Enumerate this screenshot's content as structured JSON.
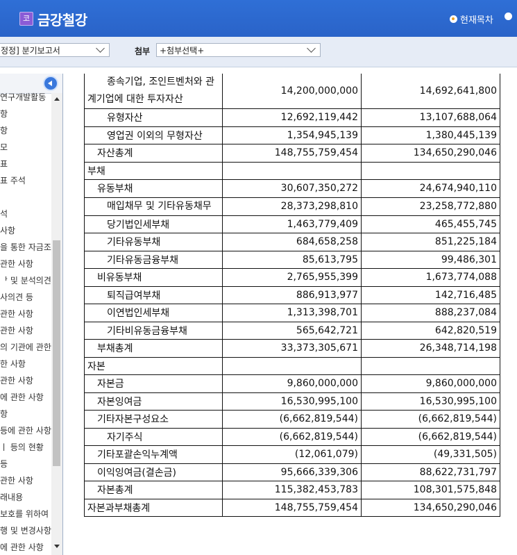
{
  "header": {
    "logo_text": "코",
    "title": "금강철강",
    "radio_current": "현재목차",
    "accent": "#2f6fd6"
  },
  "toolbar": {
    "report_select": "정정] 분기보고서",
    "attach_label": "첨부",
    "attach_select": "+첨부선택+"
  },
  "sidebar": {
    "items": [
      "연구개발활동",
      "항",
      "항",
      "모",
      "표",
      "표 주석",
      "",
      "석",
      " 사항",
      "을 통한 자금조",
      " 관한 사항",
      "ᅡ 및 분석의견",
      "사의견 등",
      "관한 사항",
      "관한 사항",
      "의 기관에 관한",
      "한 사항",
      "관한 사항",
      "에 관한 사항",
      "항",
      "등에 관한 사항",
      "ㅣ 등의 현황",
      " 등",
      "관한 사항",
      "래내용",
      " 보호를 위하여",
      "행 및 변경사항",
      "에 관한 사항"
    ]
  },
  "table": {
    "rows": [
      {
        "label": "종속기업, 조인트벤처와 관계기업에 대한 투자자산",
        "indent": 2,
        "tall": true,
        "current": "14,200,000,000",
        "prior": "14,692,641,800"
      },
      {
        "label": "유형자산",
        "indent": 2,
        "current": "12,692,119,442",
        "prior": "13,107,688,064"
      },
      {
        "label": "영업권 이외의 무형자산",
        "indent": 2,
        "current": "1,354,945,139",
        "prior": "1,380,445,139"
      },
      {
        "label": "자산총계",
        "indent": 1,
        "current": "148,755,759,454",
        "prior": "134,650,290,046"
      },
      {
        "label": "부채",
        "indent": 0,
        "current": "",
        "prior": ""
      },
      {
        "label": "유동부채",
        "indent": 1,
        "current": "30,607,350,272",
        "prior": "24,674,940,110"
      },
      {
        "label": "매입채무 및 기타유동채무",
        "indent": 2,
        "tall": true,
        "current": "28,373,298,810",
        "prior": "23,258,772,880"
      },
      {
        "label": "당기법인세부채",
        "indent": 2,
        "current": "1,463,779,409",
        "prior": "465,455,745"
      },
      {
        "label": "기타유동부채",
        "indent": 2,
        "current": "684,658,258",
        "prior": "851,225,184"
      },
      {
        "label": "기타유동금융부채",
        "indent": 2,
        "current": "85,613,795",
        "prior": "99,486,301"
      },
      {
        "label": "비유동부채",
        "indent": 1,
        "current": "2,765,955,399",
        "prior": "1,673,774,088"
      },
      {
        "label": "퇴직급여부채",
        "indent": 2,
        "current": "886,913,977",
        "prior": "142,716,485"
      },
      {
        "label": "이연법인세부채",
        "indent": 2,
        "current": "1,313,398,701",
        "prior": "888,237,084"
      },
      {
        "label": "기타비유동금융부채",
        "indent": 2,
        "current": "565,642,721",
        "prior": "642,820,519"
      },
      {
        "label": "부채총계",
        "indent": 1,
        "current": "33,373,305,671",
        "prior": "26,348,714,198"
      },
      {
        "label": "자본",
        "indent": 0,
        "current": "",
        "prior": ""
      },
      {
        "label": "자본금",
        "indent": 1,
        "current": "9,860,000,000",
        "prior": "9,860,000,000"
      },
      {
        "label": "자본잉여금",
        "indent": 1,
        "current": "16,530,995,100",
        "prior": "16,530,995,100"
      },
      {
        "label": "기타자본구성요소",
        "indent": 1,
        "current": "(6,662,819,544)",
        "prior": "(6,662,819,544)"
      },
      {
        "label": "자기주식",
        "indent": 2,
        "current": "(6,662,819,544)",
        "prior": "(6,662,819,544)"
      },
      {
        "label": "기타포괄손익누계액",
        "indent": 1,
        "current": "(12,061,079)",
        "prior": "(49,331,505)"
      },
      {
        "label": "이익잉여금(결손금)",
        "indent": 1,
        "current": "95,666,339,306",
        "prior": "88,622,731,797"
      },
      {
        "label": "자본총계",
        "indent": 1,
        "current": "115,382,453,783",
        "prior": "108,301,575,848"
      },
      {
        "label": "자본과부채총계",
        "indent": 0,
        "current": "148,755,759,454",
        "prior": "134,650,290,046"
      }
    ]
  }
}
